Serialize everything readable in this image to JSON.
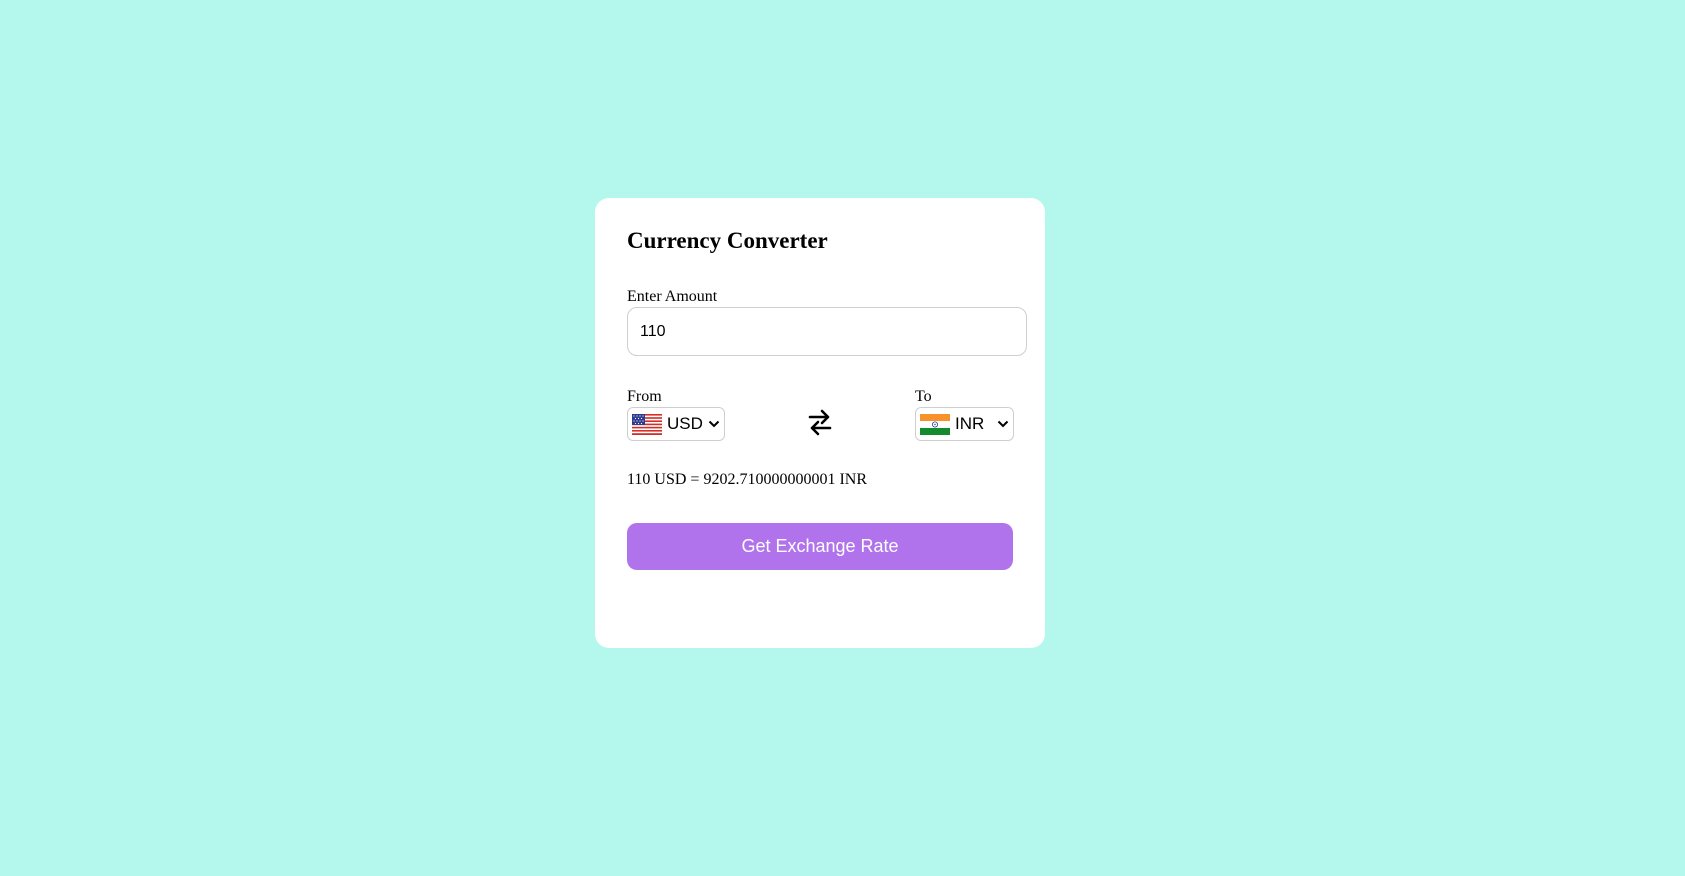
{
  "colors": {
    "page_background": "#b4f7ed",
    "card_background": "#ffffff",
    "button_background": "#b073eb",
    "button_text": "#ffffff"
  },
  "converter": {
    "title": "Currency Converter",
    "amount_label": "Enter Amount",
    "amount_value": "110",
    "from_label": "From",
    "to_label": "To",
    "from_currency": {
      "code": "USD",
      "flag_icon": "us-flag-icon"
    },
    "to_currency": {
      "code": "INR",
      "flag_icon": "india-flag-icon"
    },
    "swap_icon": "swap-arrows-icon",
    "result_text": "110 USD = 9202.710000000001 INR",
    "button_label": "Get Exchange Rate"
  }
}
